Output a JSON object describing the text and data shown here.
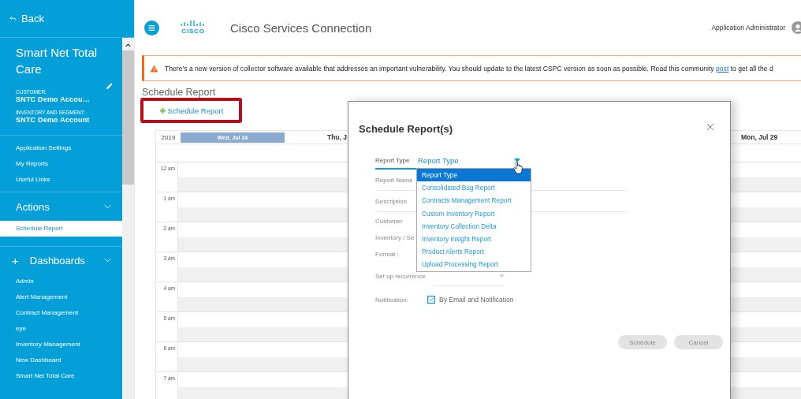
{
  "sidebar": {
    "back": "Back",
    "title": "Smart Net Total Care",
    "customer_label": "CUSTOMER:",
    "customer": "SNTC Demo Accou…",
    "inventory_label": "INVENTORY AND SEGMENT:",
    "inventory": "SNTC Demo Account",
    "links": [
      "Application Settings",
      "My Reports",
      "Useful Links"
    ],
    "sections": [
      {
        "title": "Actions",
        "items": [
          {
            "label": "Schedule Report",
            "selected": true
          }
        ]
      },
      {
        "prefix": "+",
        "title": "Dashboards",
        "items": [
          {
            "label": "Admin",
            "selected": false
          },
          {
            "label": "Alert Management",
            "selected": false
          },
          {
            "label": "Contract Management",
            "selected": false
          },
          {
            "label": "eye",
            "selected": false
          },
          {
            "label": "Inventory Management",
            "selected": false
          },
          {
            "label": "New Dashboard",
            "selected": false
          },
          {
            "label": "Smart Net Total Care",
            "selected": false
          }
        ]
      }
    ]
  },
  "header": {
    "logo": "CISCO",
    "title": "Cisco Services Connection",
    "user": "Application Administrator"
  },
  "alert": {
    "before": "There’s a new version of collector software available that addresses an important vulnerability. You should update to the latest CSPC version as soon as possible. Read this community ",
    "link": "post",
    "after": " to get all the d"
  },
  "page_title": "Schedule Report",
  "schedule_button": "Schedule Report",
  "calendar": {
    "year": "2019",
    "days": [
      {
        "label": "Wed, Jul 24",
        "selected": true
      },
      {
        "label": "Thu, J",
        "selected": false
      },
      {
        "label": "Mon, Jul 29",
        "selected": false
      }
    ],
    "hours": [
      "12 am",
      "1 am",
      "2 am",
      "3 am",
      "4 am",
      "5 am",
      "6 am",
      "7 am"
    ]
  },
  "modal": {
    "title": "Schedule Report(s)",
    "fields": [
      {
        "kind": "select",
        "label": "Report Type",
        "value": "Report Type"
      },
      {
        "kind": "text",
        "label": "Report Name"
      },
      {
        "kind": "text",
        "label": "Description"
      },
      {
        "kind": "plain",
        "label": "Customer"
      },
      {
        "kind": "plain",
        "label": "Inventory / Se"
      },
      {
        "kind": "plain",
        "label": "Format :"
      },
      {
        "kind": "dropdown",
        "label": "Set up recurrence"
      }
    ],
    "notification": {
      "label": "Notification:",
      "option": "By Email and Notification",
      "checked": true
    },
    "options": [
      {
        "label": "Report Type",
        "selected": true
      },
      {
        "label": "Consolidated Bug Report",
        "selected": false
      },
      {
        "label": "Contracts Management Report",
        "selected": false
      },
      {
        "label": "Custom Inventory Report",
        "selected": false
      },
      {
        "label": "Inventory Collection Delta",
        "selected": false
      },
      {
        "label": "Inventory Insight Report",
        "selected": false
      },
      {
        "label": "Product Alerts Report",
        "selected": false
      },
      {
        "label": "Upload Processing Report",
        "selected": false
      }
    ],
    "buttons": [
      {
        "label": "Schedule",
        "disabled": true
      },
      {
        "label": "Cancel",
        "disabled": true
      }
    ]
  }
}
